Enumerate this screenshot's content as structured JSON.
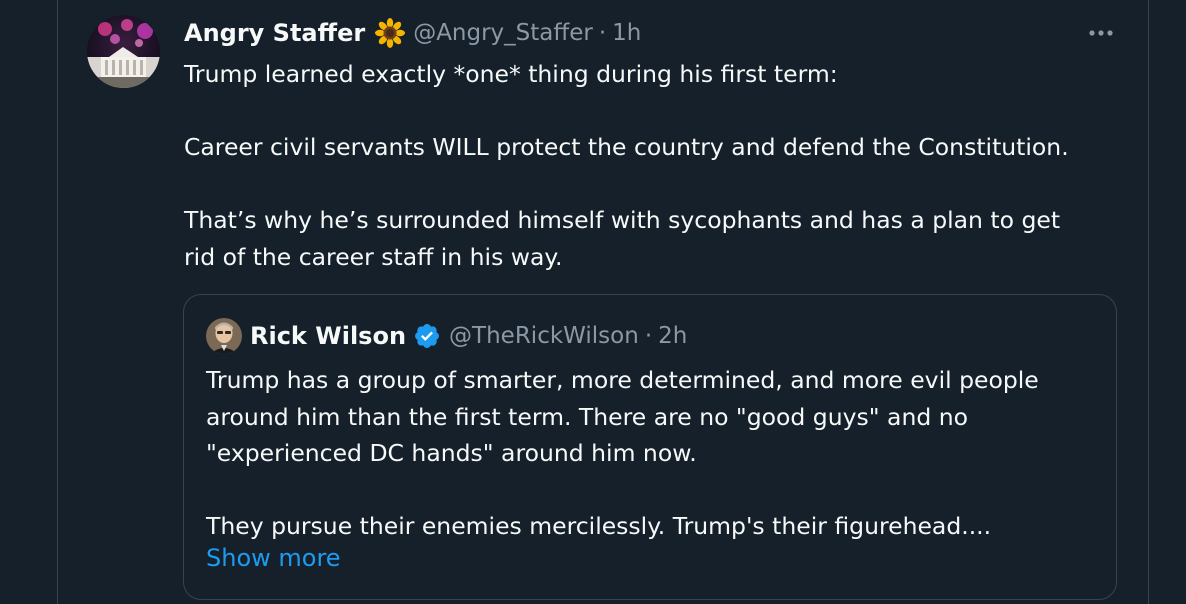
{
  "tweet": {
    "display_name": "Angry Staffer",
    "handle": "@Angry_Staffer",
    "separator": "·",
    "time": "1h",
    "text": "Trump learned exactly *one* thing during his first term:\n\nCareer civil servants WILL protect the country and defend the Constitution.\n\nThat’s why he’s surrounded himself with sycophants and has a plan to get\nrid of the career staff in his way."
  },
  "quote": {
    "display_name": "Rick Wilson",
    "handle": "@TheRickWilson",
    "separator": "·",
    "time": "2h",
    "text": "Trump has a group of smarter, more determined, and more evil people\naround him than the first term. There are no \"good guys\" and no\n\"experienced DC hands\" around him now.\n\nThey pursue their enemies mercilessly. Trump's their figurehead....",
    "show_more_label": "Show more"
  },
  "icons": {
    "more": "more-horizontal-icon",
    "verified": "verified-badge-icon",
    "emoji": "sunflower-emoji"
  },
  "colors": {
    "background": "#15202b",
    "primary_text": "#f7f9f9",
    "secondary_text": "#8b98a5",
    "accent": "#1d9bf0",
    "border": "#38444d"
  }
}
